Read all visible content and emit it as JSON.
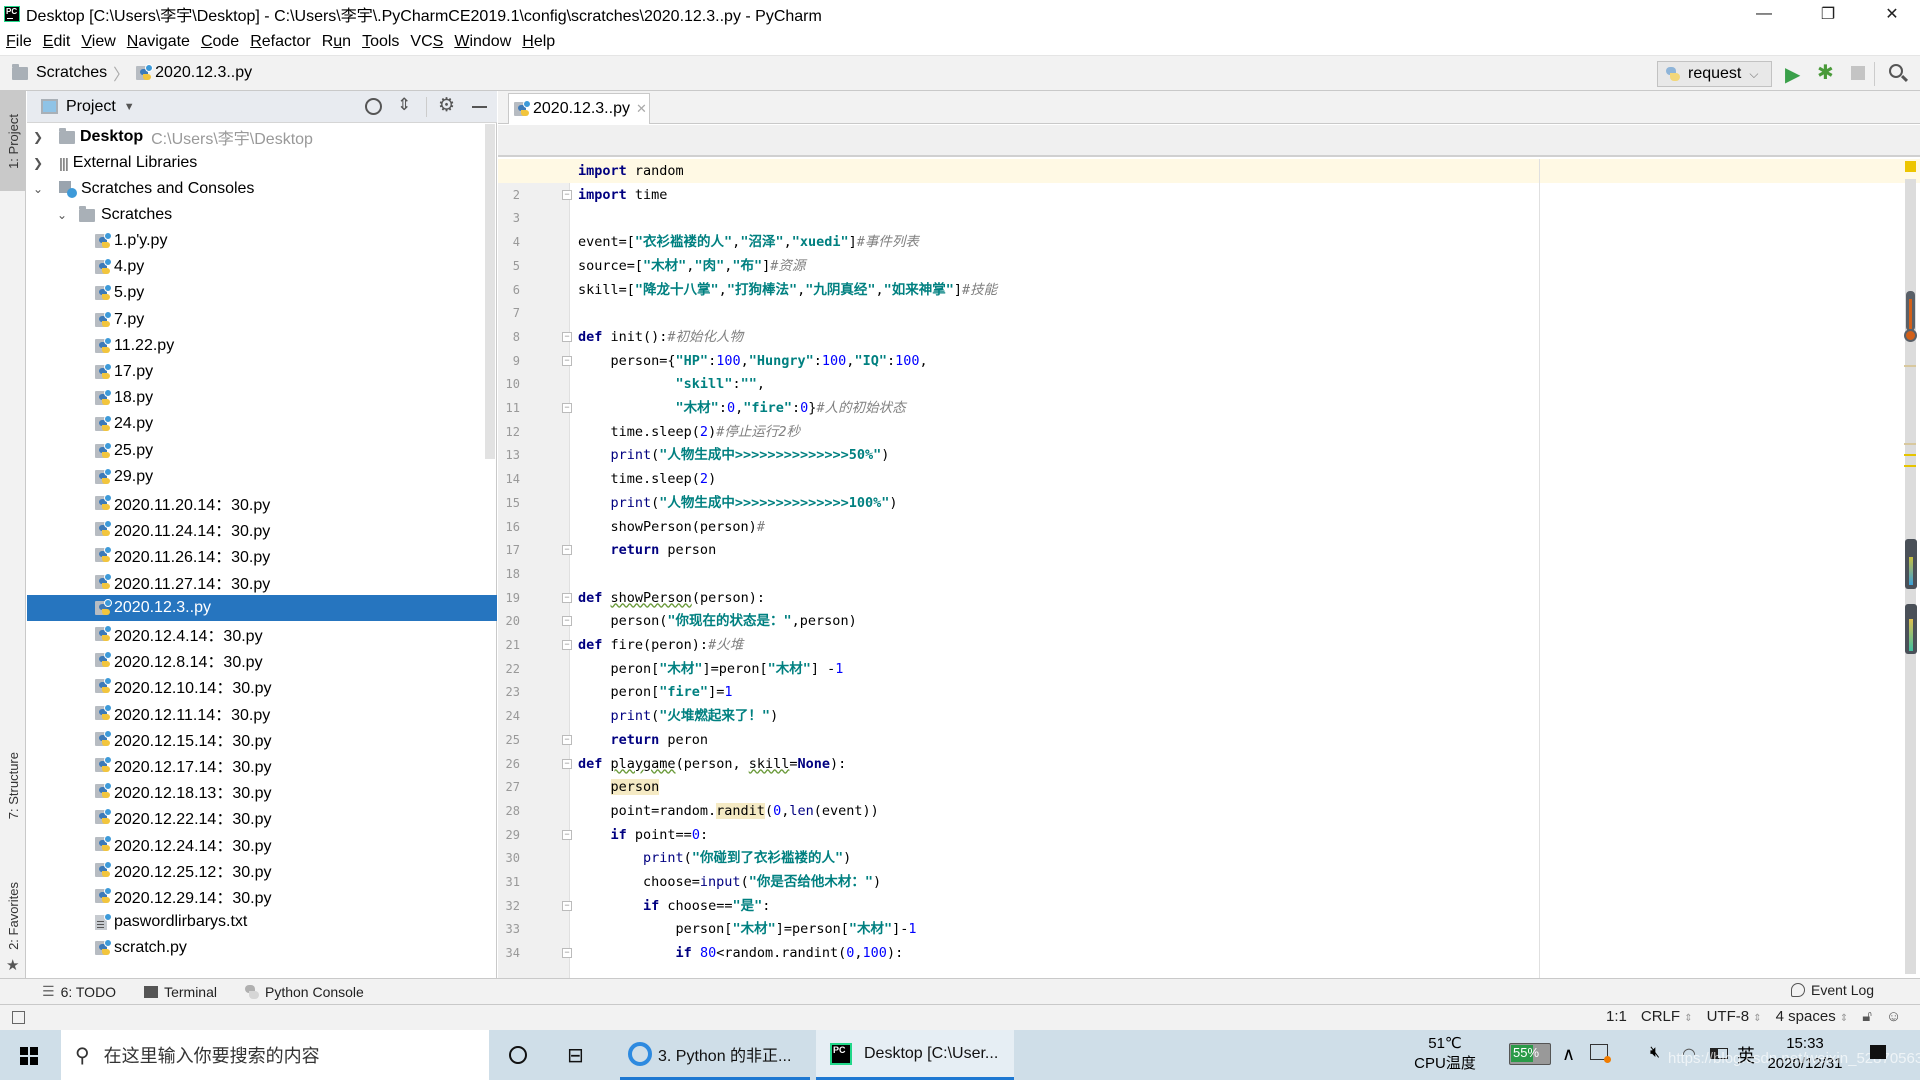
{
  "titlebar": {
    "title": "Desktop [C:\\Users\\李宇\\Desktop] - C:\\Users\\李宇\\.PyCharmCE2019.1\\config\\scratches\\2020.12.3..py - PyCharm",
    "minimize": "—",
    "maximize": "❐",
    "close": "✕"
  },
  "menubar": {
    "items": [
      {
        "label": "File",
        "mnemonic": "F"
      },
      {
        "label": "Edit",
        "mnemonic": "E"
      },
      {
        "label": "View",
        "mnemonic": "V"
      },
      {
        "label": "Navigate",
        "mnemonic": "N"
      },
      {
        "label": "Code",
        "mnemonic": "C"
      },
      {
        "label": "Refactor",
        "mnemonic": "R"
      },
      {
        "label": "Run",
        "mnemonic": "u"
      },
      {
        "label": "Tools",
        "mnemonic": "T"
      },
      {
        "label": "VCS",
        "mnemonic": "S"
      },
      {
        "label": "Window",
        "mnemonic": "W"
      },
      {
        "label": "Help",
        "mnemonic": "H"
      }
    ]
  },
  "navbar": {
    "breadcrumb": [
      "Scratches",
      "2020.12.3..py"
    ],
    "run_config": "request"
  },
  "leftstrip": {
    "project": "1: Project",
    "structure": "7: Structure",
    "favorites": "2: Favorites"
  },
  "project_panel": {
    "title": "Project",
    "root": {
      "name": "Desktop",
      "path": "C:\\Users\\李宇\\Desktop"
    },
    "external": "External Libraries",
    "scratches_consoles": "Scratches and Consoles",
    "scratches_folder": "Scratches",
    "files": [
      {
        "name": "1.p'y.py",
        "type": "py"
      },
      {
        "name": "4.py",
        "type": "py"
      },
      {
        "name": "5.py",
        "type": "py"
      },
      {
        "name": "7.py",
        "type": "py"
      },
      {
        "name": "11.22.py",
        "type": "py"
      },
      {
        "name": "17.py",
        "type": "py"
      },
      {
        "name": "18.py",
        "type": "py"
      },
      {
        "name": "24.py",
        "type": "py"
      },
      {
        "name": "25.py",
        "type": "py"
      },
      {
        "name": "29.py",
        "type": "py"
      },
      {
        "name": "2020.11.20.14：30.py",
        "type": "py"
      },
      {
        "name": "2020.11.24.14：30.py",
        "type": "py"
      },
      {
        "name": "2020.11.26.14：30.py",
        "type": "py"
      },
      {
        "name": "2020.11.27.14：30.py",
        "type": "py"
      },
      {
        "name": "2020.12.3..py",
        "type": "py",
        "selected": true
      },
      {
        "name": "2020.12.4.14：30.py",
        "type": "py"
      },
      {
        "name": "2020.12.8.14：30.py",
        "type": "py"
      },
      {
        "name": "2020.12.10.14：30.py",
        "type": "py"
      },
      {
        "name": "2020.12.11.14：30.py",
        "type": "py"
      },
      {
        "name": "2020.12.15.14：30.py",
        "type": "py"
      },
      {
        "name": "2020.12.17.14：30.py",
        "type": "py"
      },
      {
        "name": "2020.12.18.13：30.py",
        "type": "py"
      },
      {
        "name": "2020.12.22.14：30.py",
        "type": "py"
      },
      {
        "name": "2020.12.24.14：30.py",
        "type": "py"
      },
      {
        "name": "2020.12.25.12：30.py",
        "type": "py"
      },
      {
        "name": "2020.12.29.14：30.py",
        "type": "py"
      },
      {
        "name": "paswordlirbarys.txt",
        "type": "txt"
      },
      {
        "name": "scratch.py",
        "type": "py"
      }
    ]
  },
  "editor": {
    "tab": "2020.12.3..py",
    "line_count_visible": 34,
    "lines": [
      [
        [
          "kw",
          "import"
        ],
        [
          "",
          " random"
        ]
      ],
      [
        [
          "kw",
          "import"
        ],
        [
          "",
          " time"
        ]
      ],
      [],
      [
        [
          "",
          "event=["
        ],
        [
          "str",
          "\"衣衫褴褛的人\""
        ],
        [
          "",
          ","
        ],
        [
          "str",
          "\"沼泽\""
        ],
        [
          "",
          ","
        ],
        [
          "str",
          "\"xuedi\""
        ],
        [
          "",
          "]"
        ],
        [
          "cm",
          "#事件列表"
        ]
      ],
      [
        [
          "",
          "source=["
        ],
        [
          "str",
          "\"木材\""
        ],
        [
          "",
          ","
        ],
        [
          "str",
          "\"肉\""
        ],
        [
          "",
          ","
        ],
        [
          "str",
          "\"布\""
        ],
        [
          "",
          "]"
        ],
        [
          "cm",
          "#资源"
        ]
      ],
      [
        [
          "",
          "skill=["
        ],
        [
          "str",
          "\"降龙十八掌\""
        ],
        [
          "",
          ","
        ],
        [
          "str",
          "\"打狗棒法\""
        ],
        [
          "",
          ","
        ],
        [
          "str",
          "\"九阴真经\""
        ],
        [
          "",
          ","
        ],
        [
          "str",
          "\"如来神掌\""
        ],
        [
          "",
          "]"
        ],
        [
          "cm",
          "#技能"
        ]
      ],
      [],
      [
        [
          "kw",
          "def"
        ],
        [
          "",
          " init():"
        ],
        [
          "cm",
          "#初始化人物"
        ]
      ],
      [
        [
          "",
          "    person={"
        ],
        [
          "str",
          "\"HP\""
        ],
        [
          "",
          ":"
        ],
        [
          "num",
          "100"
        ],
        [
          "",
          ","
        ],
        [
          "str",
          "\"Hungry\""
        ],
        [
          "",
          ":"
        ],
        [
          "num",
          "100"
        ],
        [
          "",
          ","
        ],
        [
          "str",
          "\"IQ\""
        ],
        [
          "",
          ":"
        ],
        [
          "num",
          "100"
        ],
        [
          "",
          ","
        ]
      ],
      [
        [
          "",
          "            "
        ],
        [
          "str",
          "\"skill\""
        ],
        [
          "",
          ":"
        ],
        [
          "str",
          "\"\""
        ],
        [
          "",
          ","
        ]
      ],
      [
        [
          "",
          "            "
        ],
        [
          "str",
          "\"木材\""
        ],
        [
          "",
          ":"
        ],
        [
          "num",
          "0"
        ],
        [
          "",
          ","
        ],
        [
          "str",
          "\"fire\""
        ],
        [
          "",
          ":"
        ],
        [
          "num",
          "0"
        ],
        [
          "",
          "}"
        ],
        [
          "cm",
          "#人的初始状态"
        ]
      ],
      [
        [
          "",
          "    time.sleep("
        ],
        [
          "num",
          "2"
        ],
        [
          "",
          ")"
        ],
        [
          "cm",
          "#停止运行2秒"
        ]
      ],
      [
        [
          "",
          "    "
        ],
        [
          "bi",
          "print"
        ],
        [
          "",
          "("
        ],
        [
          "str",
          "\"人物生成中>>>>>>>>>>>>>>50%\""
        ],
        [
          "",
          ")"
        ]
      ],
      [
        [
          "",
          "    time.sleep("
        ],
        [
          "num",
          "2"
        ],
        [
          "",
          ")"
        ]
      ],
      [
        [
          "",
          "    "
        ],
        [
          "bi",
          "print"
        ],
        [
          "",
          "("
        ],
        [
          "str",
          "\"人物生成中>>>>>>>>>>>>>>100%\""
        ],
        [
          "",
          ")"
        ]
      ],
      [
        [
          "",
          "    showPerson(person)"
        ],
        [
          "cm",
          "#"
        ]
      ],
      [
        [
          "",
          "    "
        ],
        [
          "kw",
          "return"
        ],
        [
          "",
          " person"
        ]
      ],
      [],
      [
        [
          "kw",
          "def"
        ],
        [
          "",
          " "
        ],
        [
          "wavy",
          "showPerson"
        ],
        [
          "",
          "(person):"
        ]
      ],
      [
        [
          "",
          "    person("
        ],
        [
          "str",
          "\"你现在的状态是：\""
        ],
        [
          "",
          ",person)"
        ]
      ],
      [
        [
          "kw",
          "def"
        ],
        [
          "",
          " fire(peron):"
        ],
        [
          "cm",
          "#火堆"
        ]
      ],
      [
        [
          "",
          "    peron["
        ],
        [
          "str",
          "\"木材\""
        ],
        [
          "",
          "]=peron["
        ],
        [
          "str",
          "\"木材\""
        ],
        [
          "",
          "] -"
        ],
        [
          "num",
          "1"
        ]
      ],
      [
        [
          "",
          "    peron["
        ],
        [
          "str",
          "\"fire\""
        ],
        [
          "",
          "]="
        ],
        [
          "num",
          "1"
        ]
      ],
      [
        [
          "",
          "    "
        ],
        [
          "bi",
          "print"
        ],
        [
          "",
          "("
        ],
        [
          "str",
          "\"火堆燃起来了！\""
        ],
        [
          "",
          ")"
        ]
      ],
      [
        [
          "",
          "    "
        ],
        [
          "kw",
          "return"
        ],
        [
          "",
          " peron"
        ]
      ],
      [
        [
          "kw",
          "def"
        ],
        [
          "",
          " "
        ],
        [
          "wavy",
          "playgame"
        ],
        [
          "",
          "(person, "
        ],
        [
          "wavy",
          "skill"
        ],
        [
          "",
          "="
        ],
        [
          "kw",
          "None"
        ],
        [
          "",
          "):"
        ]
      ],
      [
        [
          "",
          "    "
        ],
        [
          "hl",
          "person"
        ]
      ],
      [
        [
          "",
          "    point=random."
        ],
        [
          "hl",
          "randit"
        ],
        [
          "",
          "("
        ],
        [
          "num",
          "0"
        ],
        [
          "",
          ","
        ],
        [
          "bi",
          "len"
        ],
        [
          "",
          "(event))"
        ]
      ],
      [
        [
          "",
          "    "
        ],
        [
          "kw",
          "if"
        ],
        [
          "",
          " point=="
        ],
        [
          "num",
          "0"
        ],
        [
          "",
          ":"
        ]
      ],
      [
        [
          "",
          "        "
        ],
        [
          "bi",
          "print"
        ],
        [
          "",
          "("
        ],
        [
          "str",
          "\"你碰到了衣衫褴褛的人\""
        ],
        [
          "",
          ")"
        ]
      ],
      [
        [
          "",
          "        choose="
        ],
        [
          "bi",
          "input"
        ],
        [
          "",
          "("
        ],
        [
          "str",
          "\"你是否给他木材：\""
        ],
        [
          "",
          ")"
        ]
      ],
      [
        [
          "",
          "        "
        ],
        [
          "kw",
          "if"
        ],
        [
          "",
          " choose=="
        ],
        [
          "str",
          "\"是\""
        ],
        [
          "",
          ":"
        ]
      ],
      [
        [
          "",
          "            person["
        ],
        [
          "str",
          "\"木材\""
        ],
        [
          "",
          "]=person["
        ],
        [
          "str",
          "\"木材\""
        ],
        [
          "",
          "]-"
        ],
        [
          "num",
          "1"
        ]
      ],
      [
        [
          "",
          "            "
        ],
        [
          "kw",
          "if"
        ],
        [
          "",
          " "
        ],
        [
          "num",
          "80"
        ],
        [
          "",
          "<random.randint("
        ],
        [
          "num",
          "0"
        ],
        [
          "",
          ","
        ],
        [
          "num",
          "100"
        ],
        [
          "",
          "):"
        ]
      ]
    ],
    "fold_lines": [
      1,
      2,
      8,
      9,
      11,
      17,
      19,
      20,
      21,
      25,
      26,
      29,
      32,
      34
    ]
  },
  "bottom_tools": {
    "todo": "6: TODO",
    "terminal": "Terminal",
    "python_console": "Python Console",
    "event_log": "Event Log"
  },
  "statusbar": {
    "position": "1:1",
    "line_sep": "CRLF",
    "encoding": "UTF-8",
    "indent": "4 spaces"
  },
  "taskbar": {
    "search_placeholder": "在这里输入你要搜索的内容",
    "apps": [
      {
        "label": "3. Python 的非正...",
        "icon": "browser-icon"
      },
      {
        "label": "Desktop [C:\\User...",
        "icon": "pycharm-icon",
        "active": true
      }
    ],
    "cpu_temp": "51℃",
    "cpu_label": "CPU温度",
    "battery": "55%",
    "ime": "英",
    "time": "15:33",
    "date": "2020/12/31",
    "watermark": "https://blog.csdn.net/weixin_52870563"
  }
}
